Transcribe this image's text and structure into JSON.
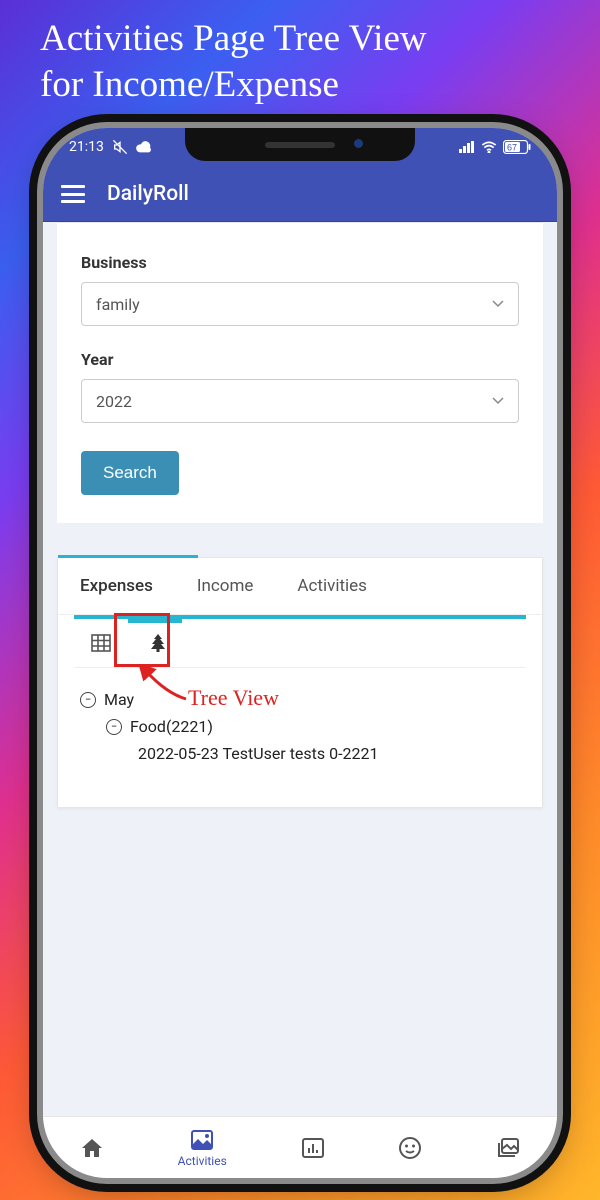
{
  "page": {
    "title_line1": "Activities Page Tree View",
    "title_line2": "for Income/Expense"
  },
  "status": {
    "time": "21:13",
    "battery": "67"
  },
  "appbar": {
    "title": "DailyRoll"
  },
  "form": {
    "business_label": "Business",
    "business_value": "family",
    "year_label": "Year",
    "year_value": "2022",
    "search_label": "Search"
  },
  "tabs": {
    "expenses": "Expenses",
    "income": "Income",
    "activities": "Activities"
  },
  "annotation": {
    "label": "Tree View"
  },
  "tree": {
    "month": "May",
    "category": "Food(2221)",
    "entry": "2022-05-23 TestUser tests 0-2221"
  },
  "bottomnav": {
    "activities": "Activities"
  }
}
